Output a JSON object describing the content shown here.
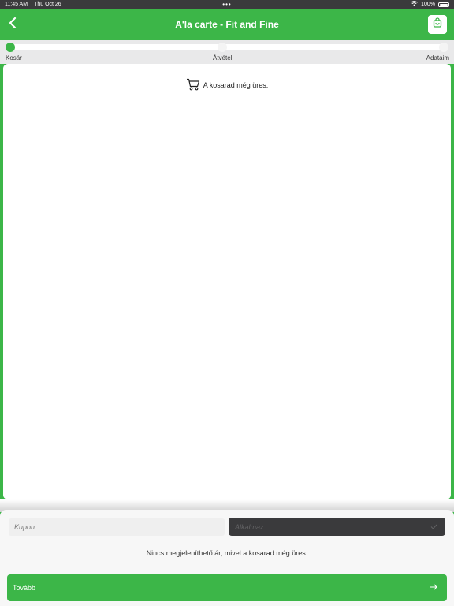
{
  "status_bar": {
    "time": "11:45 AM",
    "date": "Thu Oct 26",
    "center_dots": "•••",
    "battery_text": "100%"
  },
  "header": {
    "title": "A'la carte - Fit and Fine",
    "back_icon": "chevron-left-icon",
    "cart_icon": "shopping-bag-icon"
  },
  "steps": {
    "items": [
      "Kosár",
      "Átvétel",
      "Adataim"
    ],
    "active_index": 0
  },
  "cart": {
    "empty_message": "A kosarad még üres.",
    "icon": "cart-icon"
  },
  "bottom": {
    "coupon_placeholder": "Kupon",
    "apply_label": "Alkalmaz",
    "info_text": "Nincs megjeleníthető ár, mivel a kosarad még üres.",
    "next_label": "Tovább",
    "next_icon": "arrow-right-icon"
  },
  "colors": {
    "accent": "#3cb648",
    "dark_button": "#3a3a3c"
  }
}
